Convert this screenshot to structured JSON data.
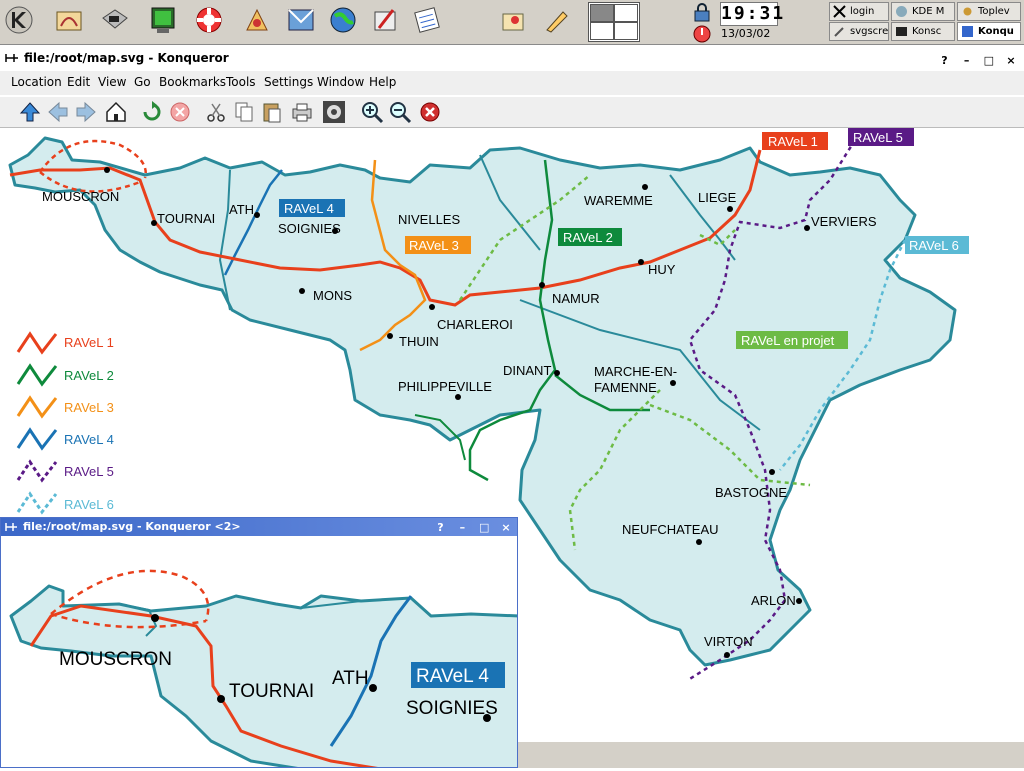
{
  "panel": {
    "launchers": [
      "kde-menu-icon",
      "home-folder-icon",
      "terminal-icon",
      "monitor-icon",
      "help-lifebuoy-icon",
      "web-browser-icon",
      "mail-icon",
      "network-icon",
      "globe-icon",
      "writer-icon",
      "calendar-icon",
      "image-editor-icon",
      "pen-icon"
    ],
    "clock": "19:31",
    "date": "13/03/02",
    "taskbar": [
      {
        "label": "login"
      },
      {
        "label": "KDE M"
      },
      {
        "label": "Toplev"
      },
      {
        "label": "svgscre"
      },
      {
        "label": "Konsc"
      },
      {
        "label": "Konqu"
      }
    ]
  },
  "window": {
    "title": "file:/root/map.svg - Konqueror",
    "menu": [
      "Location",
      "Edit",
      "View",
      "Go",
      "Bookmarks",
      "Tools",
      "Settings",
      "Window",
      "Help"
    ],
    "toolbar": [
      "up-arrow-icon",
      "back-arrow-icon",
      "forward-arrow-icon",
      "home-icon",
      "reload-icon",
      "stop-icon",
      "cut-icon",
      "copy-icon",
      "paste-icon",
      "print-icon",
      "settings-gear-icon",
      "zoom-in-icon",
      "zoom-out-icon",
      "close-red-icon"
    ],
    "buttons": {
      "help": "?",
      "minimize": "–",
      "maximize": "□",
      "close": "×"
    }
  },
  "map": {
    "cities": [
      "MOUSCRON",
      "TOURNAI",
      "ATH",
      "SOIGNIES",
      "NIVELLES",
      "MONS",
      "CHARLEROI",
      "THUIN",
      "PHILIPPEVILLE",
      "DINANT",
      "NAMUR",
      "HUY",
      "WAREMME",
      "LIEGE",
      "VERVIERS",
      "MARCHE-EN-",
      "FAMENNE",
      "BASTOGNE",
      "NEUFCHATEAU",
      "ARLON",
      "VIRTON"
    ],
    "route_labels": [
      {
        "text": "RAVeL 1",
        "color": "#e8401c"
      },
      {
        "text": "RAVeL 2",
        "color": "#0e8a3c"
      },
      {
        "text": "RAVeL 3",
        "color": "#f39017"
      },
      {
        "text": "RAVeL 4",
        "color": "#1a73b4"
      },
      {
        "text": "RAVeL 5",
        "color": "#5a1a86"
      },
      {
        "text": "RAVeL 6",
        "color": "#5bbad5"
      },
      {
        "text": "RAVeL en projet",
        "color": "#6dbb45"
      }
    ],
    "legend": [
      {
        "label": "RAVeL 1",
        "color": "#e8401c",
        "dashed": false
      },
      {
        "label": "RAVeL 2",
        "color": "#0e8a3c",
        "dashed": false
      },
      {
        "label": "RAVeL 3",
        "color": "#f39017",
        "dashed": false
      },
      {
        "label": "RAVeL 4",
        "color": "#1a73b4",
        "dashed": false
      },
      {
        "label": "RAVeL 5",
        "color": "#5a1a86",
        "dashed": true
      },
      {
        "label": "RAVeL 6",
        "color": "#5bbad5",
        "dashed": true
      }
    ],
    "land_color": "#d4ecee",
    "border_color": "#2a8a9a"
  },
  "window2": {
    "title": "file:/root/map.svg - Konqueror <2>",
    "cities": [
      "MOUSCRON",
      "TOURNAI",
      "ATH",
      "SOIGNIES"
    ],
    "route_label": "RAVeL 4"
  }
}
